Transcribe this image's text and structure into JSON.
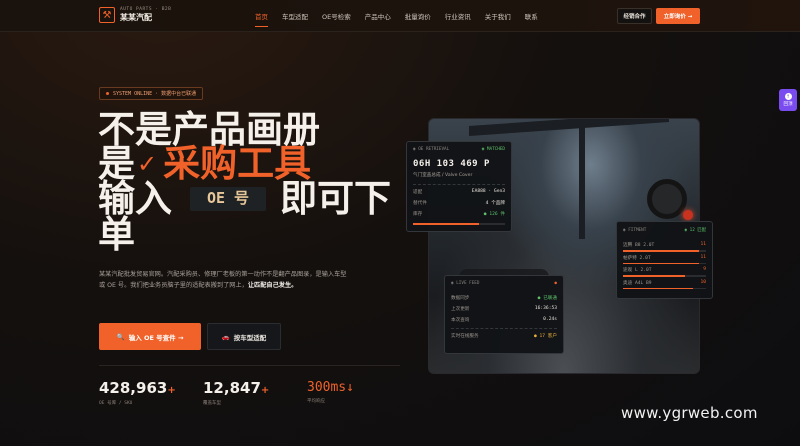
{
  "nav": {
    "logo_icon": "wrench-box-icon",
    "logo_sub": "AUTO PARTS · B2B",
    "logo_name": "某某汽配",
    "items": [
      {
        "label": "首页",
        "active": true
      },
      {
        "label": "车型适配",
        "active": false
      },
      {
        "label": "OE号检索",
        "active": false
      },
      {
        "label": "产品中心",
        "active": false
      },
      {
        "label": "批量询价",
        "active": false
      },
      {
        "label": "行业资讯",
        "active": false
      },
      {
        "label": "关于我们",
        "active": false
      },
      {
        "label": "联系",
        "active": false
      }
    ],
    "btn_secondary": "经销合作",
    "btn_primary": "立即询价 →"
  },
  "hero": {
    "badge": "SYSTEM ONLINE · 数据中台已联通",
    "line1": "不是产品画册",
    "line2_pre": "是",
    "line2_check": "✓",
    "line2_hl": "采购工具",
    "line3_pre": "输入",
    "line3_chip": "OE 号",
    "line3_post": "即可下",
    "line4": "单",
    "desc": "某某汽配批发贸易官网。汽配采购员、修理厂老板的第一动作不是翻产品图录，是输入车型或 OE 号。我们把业务员脑子里的适配表搬到了网上，",
    "desc_bold": "让匹配自己发生。",
    "cta_primary": "输入 OE 号查件 →",
    "cta_secondary": "按车型适配",
    "stats": [
      {
        "num": "428,963",
        "suffix": "+",
        "label": "OE 号库 / SKU"
      },
      {
        "num": "12,847",
        "suffix": "+",
        "label": "覆盖车型"
      },
      {
        "num": "300ms",
        "suffix": "↓",
        "label": "平均响应"
      }
    ]
  },
  "card_oe": {
    "title": "OE RETRIEVAL",
    "status": "MATCHED",
    "oe": "06H 103 469 P",
    "part": "气门室盖总成 / Valve Cover",
    "rows": [
      {
        "k": "适配",
        "v": "EA888 · Gen3"
      },
      {
        "k": "替代件",
        "v": "4 个品牌"
      },
      {
        "k": "库存",
        "v": "● 126 件"
      }
    ],
    "progress": 0.72
  },
  "card_fitment": {
    "title": "FITMENT",
    "status": "12 匹配",
    "rows": [
      {
        "k": "迈腾 B8 2.0T",
        "v": "11",
        "fill": 0.92
      },
      {
        "k": "帕萨特 2.0T",
        "v": "11",
        "fill": 0.92
      },
      {
        "k": "途观 L 2.0T",
        "v": "9",
        "fill": 0.75
      },
      {
        "k": "奥迪 A4L B9",
        "v": "10",
        "fill": 0.84
      }
    ]
  },
  "card_live": {
    "title": "LIVE FEED",
    "rows": [
      {
        "k": "数据同步",
        "v": "● 已联通"
      },
      {
        "k": "上次更新",
        "v": "16:36:53"
      },
      {
        "k": "本次查询",
        "v": "0.24s"
      }
    ],
    "foot_k": "实时在线服务",
    "foot_v": "● 17 客户"
  },
  "sidetab": {
    "label": "回顶",
    "icon": "arrow-up-icon"
  },
  "watermark": "www.ygrweb.com",
  "colors": {
    "accent": "#f0622a",
    "ok": "#5ec26a",
    "side": "#7a4cf0"
  }
}
